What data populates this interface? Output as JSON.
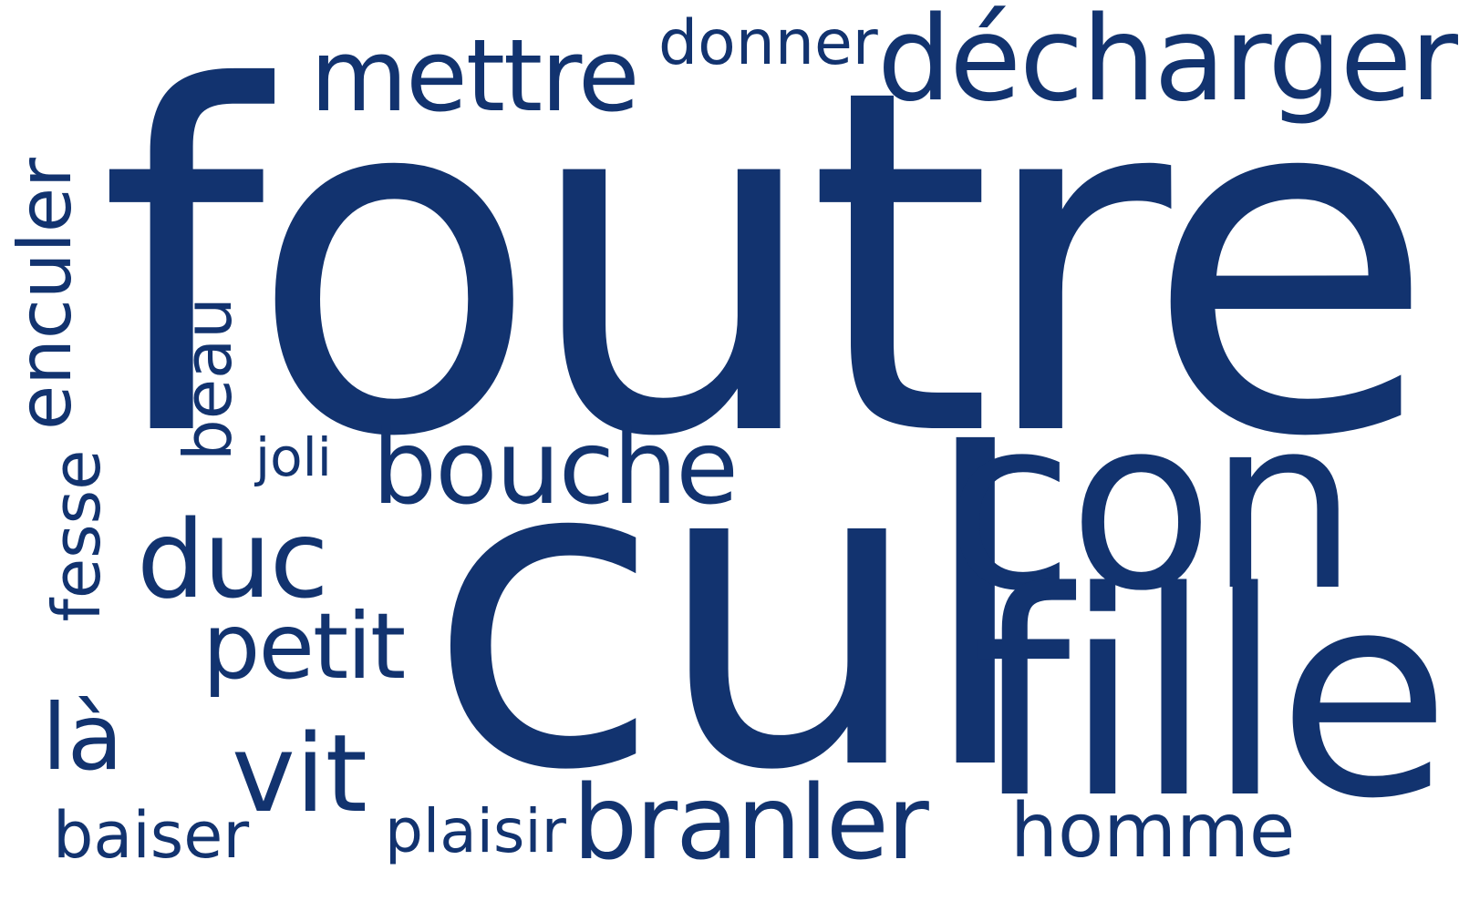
{
  "words": {
    "foutre": "foutre",
    "cul": "cul",
    "con": "con",
    "fille": "fille",
    "decharger": "décharger",
    "mettre": "mettre",
    "donner": "donner",
    "enculer": "enculer",
    "beau": "beau",
    "joli": "joli",
    "bouche": "bouche",
    "fesse": "fesse",
    "duc": "duc",
    "petit": "petit",
    "la": "là",
    "vit": "vit",
    "baiser": "baiser",
    "plaisir": "plaisir",
    "branler": "branler",
    "homme": "homme"
  },
  "colors": {
    "text": "#12336f",
    "background": "#ffffff"
  }
}
